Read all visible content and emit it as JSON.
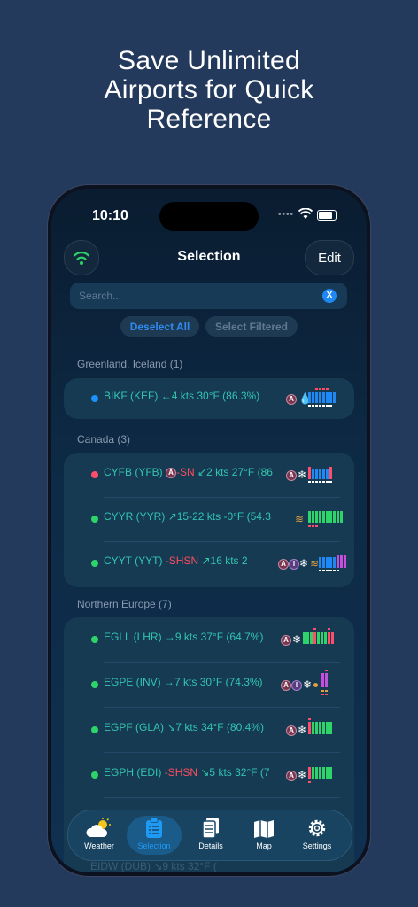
{
  "headline": [
    "Save Unlimited",
    "Airports for Quick",
    "Reference"
  ],
  "status": {
    "time": "10:10"
  },
  "nav": {
    "title": "Selection",
    "edit": "Edit"
  },
  "search": {
    "placeholder": "Search...",
    "clear": "X"
  },
  "buttons": {
    "deselect_all": "Deselect All",
    "select_filtered": "Select Filtered"
  },
  "sections": [
    {
      "label": "Greenland, Iceland (1)",
      "rows": [
        {
          "dot": "#1e90ff",
          "code": "BIKF (KEF)",
          "wx": "",
          "wind": "←4 kts",
          "temp": "30°F (86.3%)"
        }
      ]
    },
    {
      "label": "Canada (3)",
      "rows": [
        {
          "dot": "#ff4d6a",
          "code": "CYFB (YFB)",
          "wx": "-SN",
          "wind": "↙2 kts",
          "temp": "27°F (86"
        },
        {
          "dot": "#2ed36a",
          "code": "CYYR (YYR)",
          "wx": "",
          "wind": "↗15-22 kts",
          "temp": "-0°F (54.3"
        },
        {
          "dot": "#2ed36a",
          "code": "CYYT (YYT)",
          "wx": "-SHSN",
          "wind": "↗16 kts",
          "temp": "2"
        }
      ]
    },
    {
      "label": "Northern Europe (7)",
      "rows": [
        {
          "dot": "#2ed36a",
          "code": "EGLL (LHR)",
          "wx": "",
          "wind": "→9 kts",
          "temp": "37°F (64.7%)"
        },
        {
          "dot": "#2ed36a",
          "code": "EGPE (INV)",
          "wx": "",
          "wind": "→7 kts",
          "temp": "30°F (74.3%)"
        },
        {
          "dot": "#2ed36a",
          "code": "EGPF (GLA)",
          "wx": "",
          "wind": "↘7 kts",
          "temp": "34°F (80.4%)"
        },
        {
          "dot": "#2ed36a",
          "code": "EGPH (EDI)",
          "wx": "-SHSN",
          "wind": "↘5 kts",
          "temp": "32°F (7"
        }
      ]
    }
  ],
  "ghost_row": "EIDW (DUB)  ↘9 kts  32°F (",
  "tabs": [
    {
      "label": "Weather",
      "icon": "cloud-sun-icon"
    },
    {
      "label": "Selection",
      "icon": "clipboard-icon",
      "selected": true
    },
    {
      "label": "Details",
      "icon": "documents-icon"
    },
    {
      "label": "Map",
      "icon": "map-icon"
    },
    {
      "label": "Settings",
      "icon": "gear-icon"
    }
  ],
  "colors": {
    "accent": "#1e88f5",
    "cyan_text": "#33c4b0",
    "red_text": "#ff4d5e",
    "green_dot": "#2ed36a"
  }
}
